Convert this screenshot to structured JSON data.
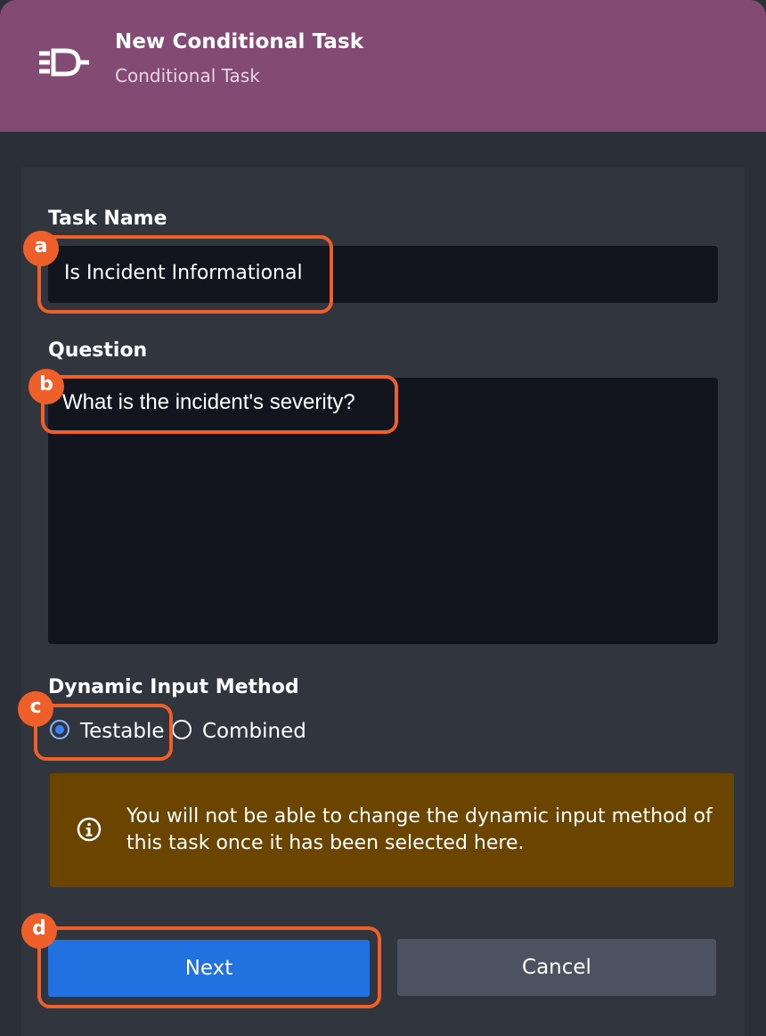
{
  "header": {
    "title": "New Conditional Task",
    "subtitle": "Conditional Task",
    "icon": "conditional-task-icon",
    "bg_color": "#834a73"
  },
  "form": {
    "task_name_label": "Task Name",
    "task_name_value": "Is Incident Informational",
    "question_label": "Question",
    "question_value": "What is the incident's severity?",
    "dynamic_input_label": "Dynamic Input Method",
    "options": [
      {
        "label": "Testable",
        "selected": true
      },
      {
        "label": "Combined",
        "selected": false
      }
    ]
  },
  "notice": {
    "icon": "info-icon",
    "text": "You will not be able to change the dynamic input method of this task once it has been selected here.",
    "bg_color": "#6b4500"
  },
  "buttons": {
    "next": "Next",
    "cancel": "Cancel"
  },
  "callouts": {
    "a": "a",
    "b": "b",
    "c": "c",
    "d": "d",
    "color": "#ef5f29"
  }
}
